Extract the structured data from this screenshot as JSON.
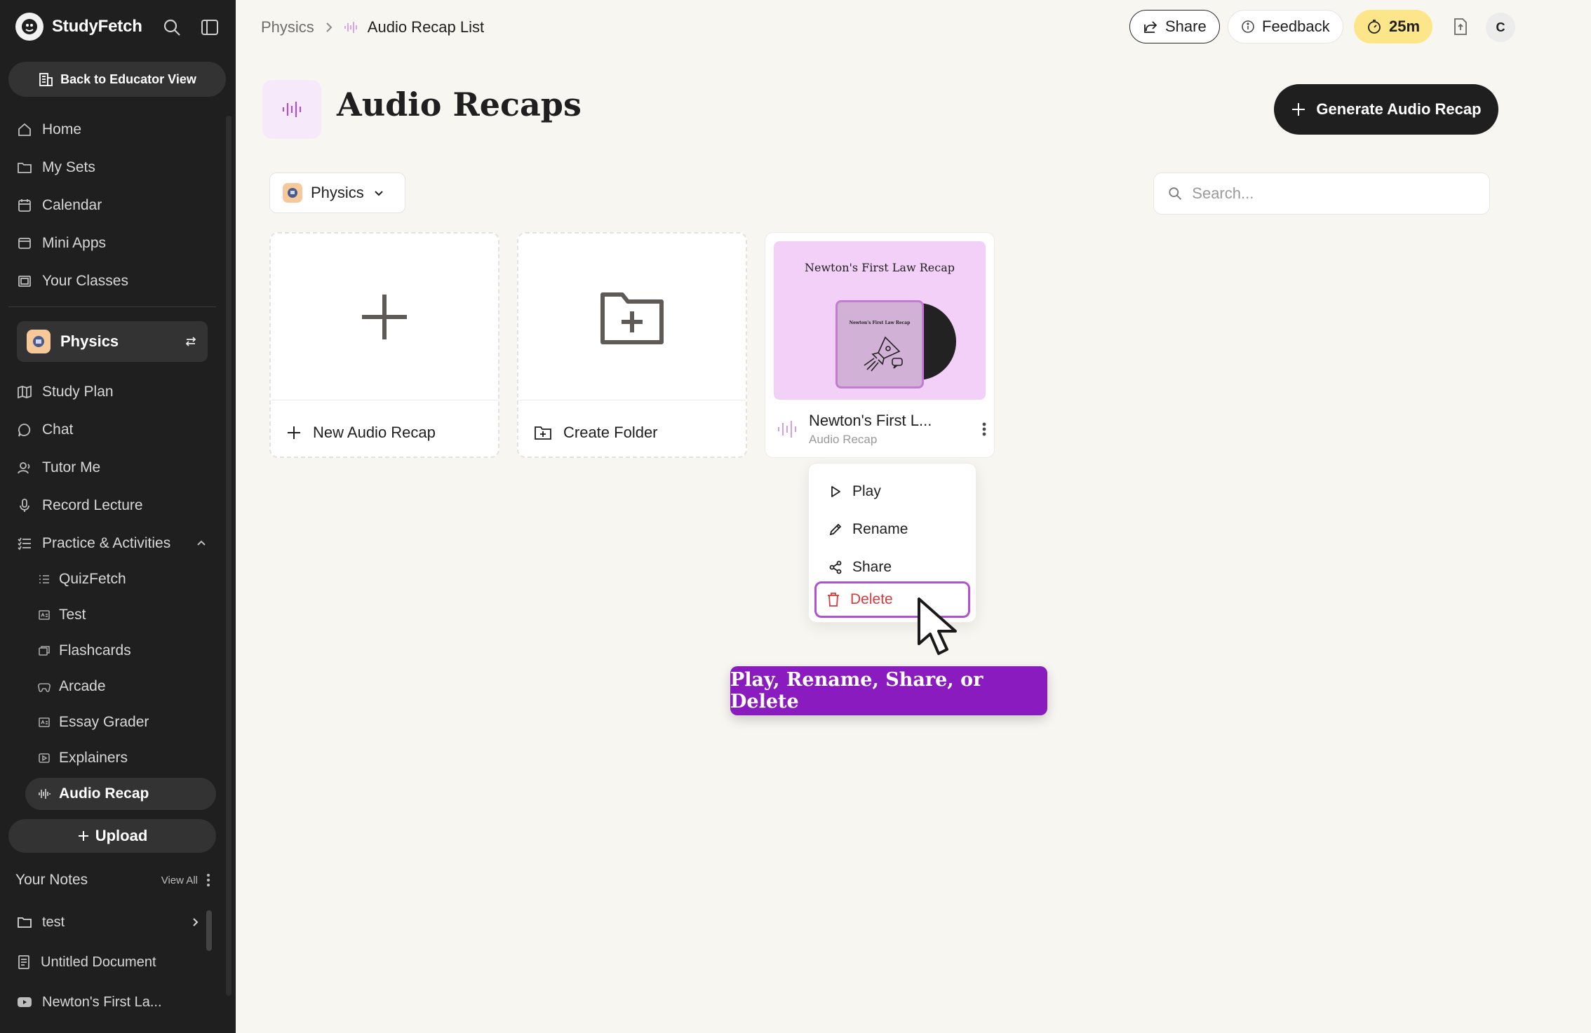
{
  "brand": {
    "name": "StudyFetch"
  },
  "sidebar": {
    "educator_button": "Back to Educator View",
    "nav": [
      {
        "label": "Home",
        "icon": "home-icon"
      },
      {
        "label": "My Sets",
        "icon": "folder-icon"
      },
      {
        "label": "Calendar",
        "icon": "calendar-icon"
      },
      {
        "label": "Mini Apps",
        "icon": "apps-icon"
      },
      {
        "label": "Your Classes",
        "icon": "classes-icon"
      }
    ],
    "class_name": "Physics",
    "class_nav": [
      {
        "label": "Study Plan",
        "icon": "map-icon"
      },
      {
        "label": "Chat",
        "icon": "chat-icon"
      },
      {
        "label": "Tutor Me",
        "icon": "tutor-icon"
      },
      {
        "label": "Record Lecture",
        "icon": "mic-icon"
      },
      {
        "label": "Practice & Activities",
        "icon": "list-icon"
      }
    ],
    "activities": [
      {
        "label": "QuizFetch"
      },
      {
        "label": "Test"
      },
      {
        "label": "Flashcards"
      },
      {
        "label": "Arcade"
      },
      {
        "label": "Essay Grader"
      },
      {
        "label": "Explainers"
      },
      {
        "label": "Audio Recap"
      }
    ],
    "upload_label": "Upload",
    "notes_title": "Your Notes",
    "notes_view_all": "View All",
    "notes": [
      {
        "label": "test",
        "icon": "folder-icon"
      },
      {
        "label": "Untitled Document",
        "icon": "document-icon"
      },
      {
        "label": "Newton's First La...",
        "icon": "youtube-icon"
      }
    ]
  },
  "header": {
    "breadcrumb_parent": "Physics",
    "breadcrumb_current": "Audio Recap List",
    "share_label": "Share",
    "feedback_label": "Feedback",
    "timer_label": "25m",
    "avatar_initial": "C"
  },
  "main": {
    "title": "Audio Recaps",
    "generate_button": "Generate Audio Recap",
    "filter_label": "Physics",
    "search_placeholder": "Search...",
    "new_card_label": "New Audio Recap",
    "folder_card_label": "Create Folder",
    "recap": {
      "cover_title": "Newton's First Law Recap",
      "sleeve_title": "Newton's First Law Recap",
      "name": "Newton's First L...",
      "type": "Audio Recap"
    }
  },
  "menu": {
    "items": [
      {
        "label": "Play"
      },
      {
        "label": "Rename"
      },
      {
        "label": "Share"
      },
      {
        "label": "Delete"
      }
    ]
  },
  "tooltip": {
    "text": "Play, Rename, Share, or Delete"
  },
  "colors": {
    "sidebar_bg": "#1f1f1f",
    "page_bg": "#f7f6f1",
    "accent_purple": "#8a1bbf",
    "danger_red": "#d63a3a",
    "timer_yellow": "#fde68a",
    "cover_pink": "#f3d0f7"
  }
}
